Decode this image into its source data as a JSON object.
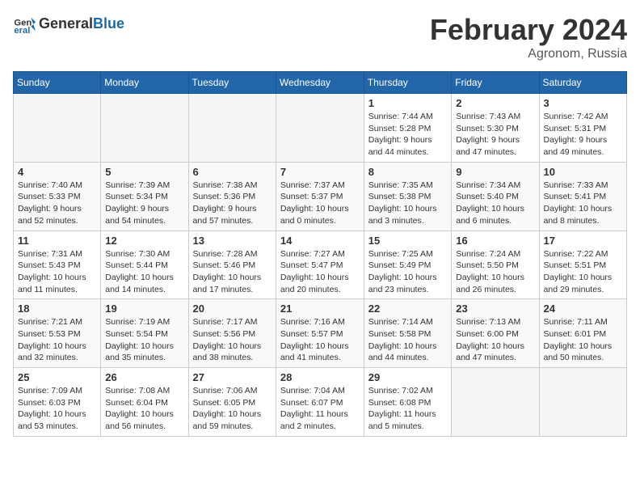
{
  "header": {
    "logo_general": "General",
    "logo_blue": "Blue",
    "title": "February 2024",
    "subtitle": "Agronom, Russia"
  },
  "weekdays": [
    "Sunday",
    "Monday",
    "Tuesday",
    "Wednesday",
    "Thursday",
    "Friday",
    "Saturday"
  ],
  "weeks": [
    [
      {
        "day": "",
        "info": ""
      },
      {
        "day": "",
        "info": ""
      },
      {
        "day": "",
        "info": ""
      },
      {
        "day": "",
        "info": ""
      },
      {
        "day": "1",
        "info": "Sunrise: 7:44 AM\nSunset: 5:28 PM\nDaylight: 9 hours and 44 minutes."
      },
      {
        "day": "2",
        "info": "Sunrise: 7:43 AM\nSunset: 5:30 PM\nDaylight: 9 hours and 47 minutes."
      },
      {
        "day": "3",
        "info": "Sunrise: 7:42 AM\nSunset: 5:31 PM\nDaylight: 9 hours and 49 minutes."
      }
    ],
    [
      {
        "day": "4",
        "info": "Sunrise: 7:40 AM\nSunset: 5:33 PM\nDaylight: 9 hours and 52 minutes."
      },
      {
        "day": "5",
        "info": "Sunrise: 7:39 AM\nSunset: 5:34 PM\nDaylight: 9 hours and 54 minutes."
      },
      {
        "day": "6",
        "info": "Sunrise: 7:38 AM\nSunset: 5:36 PM\nDaylight: 9 hours and 57 minutes."
      },
      {
        "day": "7",
        "info": "Sunrise: 7:37 AM\nSunset: 5:37 PM\nDaylight: 10 hours and 0 minutes."
      },
      {
        "day": "8",
        "info": "Sunrise: 7:35 AM\nSunset: 5:38 PM\nDaylight: 10 hours and 3 minutes."
      },
      {
        "day": "9",
        "info": "Sunrise: 7:34 AM\nSunset: 5:40 PM\nDaylight: 10 hours and 6 minutes."
      },
      {
        "day": "10",
        "info": "Sunrise: 7:33 AM\nSunset: 5:41 PM\nDaylight: 10 hours and 8 minutes."
      }
    ],
    [
      {
        "day": "11",
        "info": "Sunrise: 7:31 AM\nSunset: 5:43 PM\nDaylight: 10 hours and 11 minutes."
      },
      {
        "day": "12",
        "info": "Sunrise: 7:30 AM\nSunset: 5:44 PM\nDaylight: 10 hours and 14 minutes."
      },
      {
        "day": "13",
        "info": "Sunrise: 7:28 AM\nSunset: 5:46 PM\nDaylight: 10 hours and 17 minutes."
      },
      {
        "day": "14",
        "info": "Sunrise: 7:27 AM\nSunset: 5:47 PM\nDaylight: 10 hours and 20 minutes."
      },
      {
        "day": "15",
        "info": "Sunrise: 7:25 AM\nSunset: 5:49 PM\nDaylight: 10 hours and 23 minutes."
      },
      {
        "day": "16",
        "info": "Sunrise: 7:24 AM\nSunset: 5:50 PM\nDaylight: 10 hours and 26 minutes."
      },
      {
        "day": "17",
        "info": "Sunrise: 7:22 AM\nSunset: 5:51 PM\nDaylight: 10 hours and 29 minutes."
      }
    ],
    [
      {
        "day": "18",
        "info": "Sunrise: 7:21 AM\nSunset: 5:53 PM\nDaylight: 10 hours and 32 minutes."
      },
      {
        "day": "19",
        "info": "Sunrise: 7:19 AM\nSunset: 5:54 PM\nDaylight: 10 hours and 35 minutes."
      },
      {
        "day": "20",
        "info": "Sunrise: 7:17 AM\nSunset: 5:56 PM\nDaylight: 10 hours and 38 minutes."
      },
      {
        "day": "21",
        "info": "Sunrise: 7:16 AM\nSunset: 5:57 PM\nDaylight: 10 hours and 41 minutes."
      },
      {
        "day": "22",
        "info": "Sunrise: 7:14 AM\nSunset: 5:58 PM\nDaylight: 10 hours and 44 minutes."
      },
      {
        "day": "23",
        "info": "Sunrise: 7:13 AM\nSunset: 6:00 PM\nDaylight: 10 hours and 47 minutes."
      },
      {
        "day": "24",
        "info": "Sunrise: 7:11 AM\nSunset: 6:01 PM\nDaylight: 10 hours and 50 minutes."
      }
    ],
    [
      {
        "day": "25",
        "info": "Sunrise: 7:09 AM\nSunset: 6:03 PM\nDaylight: 10 hours and 53 minutes."
      },
      {
        "day": "26",
        "info": "Sunrise: 7:08 AM\nSunset: 6:04 PM\nDaylight: 10 hours and 56 minutes."
      },
      {
        "day": "27",
        "info": "Sunrise: 7:06 AM\nSunset: 6:05 PM\nDaylight: 10 hours and 59 minutes."
      },
      {
        "day": "28",
        "info": "Sunrise: 7:04 AM\nSunset: 6:07 PM\nDaylight: 11 hours and 2 minutes."
      },
      {
        "day": "29",
        "info": "Sunrise: 7:02 AM\nSunset: 6:08 PM\nDaylight: 11 hours and 5 minutes."
      },
      {
        "day": "",
        "info": ""
      },
      {
        "day": "",
        "info": ""
      }
    ]
  ]
}
